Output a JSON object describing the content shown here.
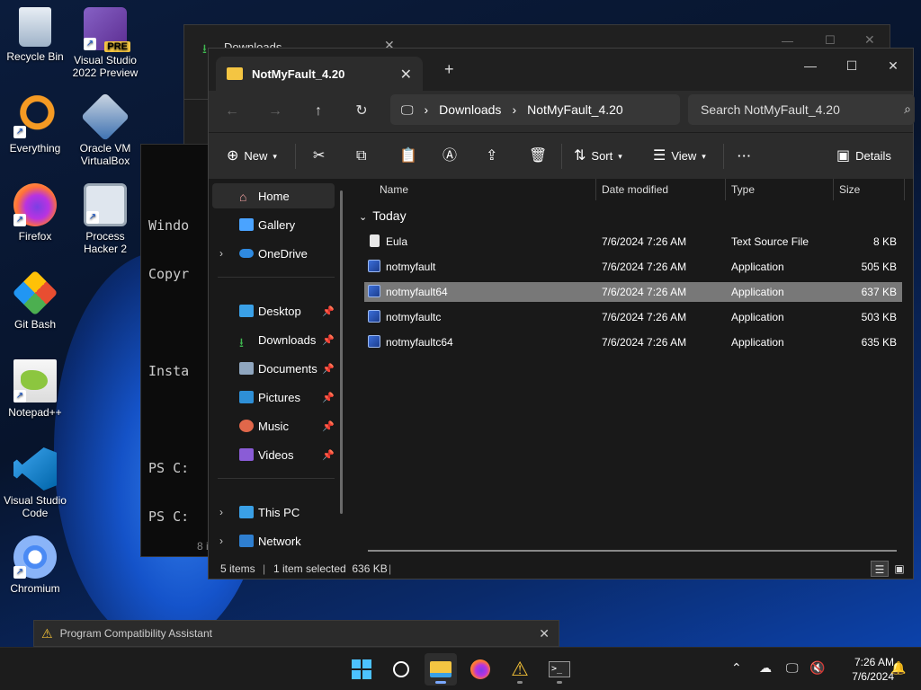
{
  "desktop": {
    "icons": [
      {
        "label": "Recycle Bin",
        "icon": "recycle-bin-icon"
      },
      {
        "label": "Visual Studio 2022 Preview",
        "icon": "visual-studio-icon",
        "badge": "PRE"
      },
      {
        "label": "Everything",
        "icon": "everything-search-icon"
      },
      {
        "label": "Oracle VM VirtualBox",
        "icon": "virtualbox-icon"
      },
      {
        "label": "Firefox",
        "icon": "firefox-icon"
      },
      {
        "label": "Process Hacker 2",
        "icon": "process-hacker-icon"
      },
      {
        "label": "Git Bash",
        "icon": "git-bash-icon"
      },
      {
        "label": "Notepad++",
        "icon": "notepad-plus-plus-icon"
      },
      {
        "label": "Visual Studio Code",
        "icon": "vscode-icon"
      },
      {
        "label": "Chromium",
        "icon": "chromium-icon"
      }
    ]
  },
  "background": {
    "downloads_tab": "Downloads",
    "term_lines": [
      "Windo",
      "Copyr",
      "",
      "Insta",
      "",
      "PS C:",
      "PS C:"
    ],
    "term_side_text": "8 i"
  },
  "explorer": {
    "tab_title": "NotMyFault_4.20",
    "breadcrumb": [
      "Downloads",
      "NotMyFault_4.20"
    ],
    "search_placeholder": "Search NotMyFault_4.20",
    "toolbar": {
      "new_label": "New",
      "sort_label": "Sort",
      "view_label": "View",
      "more_label": "···",
      "details_label": "Details"
    },
    "nav": {
      "home": "Home",
      "gallery": "Gallery",
      "onedrive": "OneDrive",
      "desktop": "Desktop",
      "downloads": "Downloads",
      "documents": "Documents",
      "pictures": "Pictures",
      "music": "Music",
      "videos": "Videos",
      "this_pc": "This PC",
      "network": "Network"
    },
    "columns": {
      "name": "Name",
      "date": "Date modified",
      "type": "Type",
      "size": "Size"
    },
    "group_label": "Today",
    "files": [
      {
        "name": "Eula",
        "date": "7/6/2024 7:26 AM",
        "type": "Text Source File",
        "size": "8 KB",
        "icon": "text-file-icon"
      },
      {
        "name": "notmyfault",
        "date": "7/6/2024 7:26 AM",
        "type": "Application",
        "size": "505 KB",
        "icon": "application-icon"
      },
      {
        "name": "notmyfault64",
        "date": "7/6/2024 7:26 AM",
        "type": "Application",
        "size": "637 KB",
        "icon": "application-icon",
        "selected": true
      },
      {
        "name": "notmyfaultc",
        "date": "7/6/2024 7:26 AM",
        "type": "Application",
        "size": "503 KB",
        "icon": "application-icon"
      },
      {
        "name": "notmyfaultc64",
        "date": "7/6/2024 7:26 AM",
        "type": "Application",
        "size": "635 KB",
        "icon": "application-icon"
      }
    ],
    "status": {
      "items": "5 items",
      "selected": "1 item selected  636 KB"
    }
  },
  "notification": {
    "text": "Program Compatibility Assistant"
  },
  "taskbar": {
    "clock_time": "7:26 AM",
    "clock_date": "7/6/2024"
  },
  "colors": {
    "accent": "#7aa8ff",
    "folder": "#f4c542",
    "selected_row": "#787878"
  }
}
